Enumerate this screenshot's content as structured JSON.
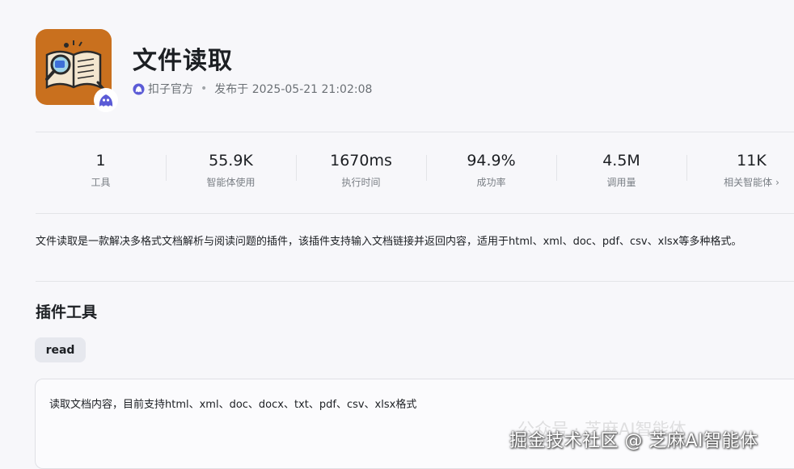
{
  "plugin": {
    "name": "文件读取",
    "author": "扣子官方",
    "published": "发布于 2025-05-21 21:02:08"
  },
  "stats": [
    {
      "value": "1",
      "label": "工具"
    },
    {
      "value": "55.9K",
      "label": "智能体使用"
    },
    {
      "value": "1670ms",
      "label": "执行时间"
    },
    {
      "value": "94.9%",
      "label": "成功率"
    },
    {
      "value": "4.5M",
      "label": "调用量"
    },
    {
      "value": "11K",
      "label": "相关智能体"
    }
  ],
  "description": "文件读取是一款解决多格式文档解析与阅读问题的插件，该插件支持输入文档链接并返回内容，适用于html、xml、doc、pdf、csv、xlsx等多种格式。",
  "tools_section": {
    "title": "插件工具",
    "tabs": [
      {
        "label": "read"
      }
    ],
    "active_tool_description": "读取文档内容，目前支持html、xml、doc、docx、txt、pdf、csv、xlsx格式"
  },
  "watermarks": {
    "faint": "公众号 · 芝麻AI智能体",
    "main": "掘金技术社区 @ 芝麻AI智能体"
  },
  "colors": {
    "logo_bg": "#c9701e",
    "badge": "#5b5bd6"
  },
  "icons": {
    "logo": "open-book-magnifier-icon",
    "badge": "coze-bot-icon",
    "author": "coze-author-icon",
    "chevron": "chevron-right-icon"
  }
}
